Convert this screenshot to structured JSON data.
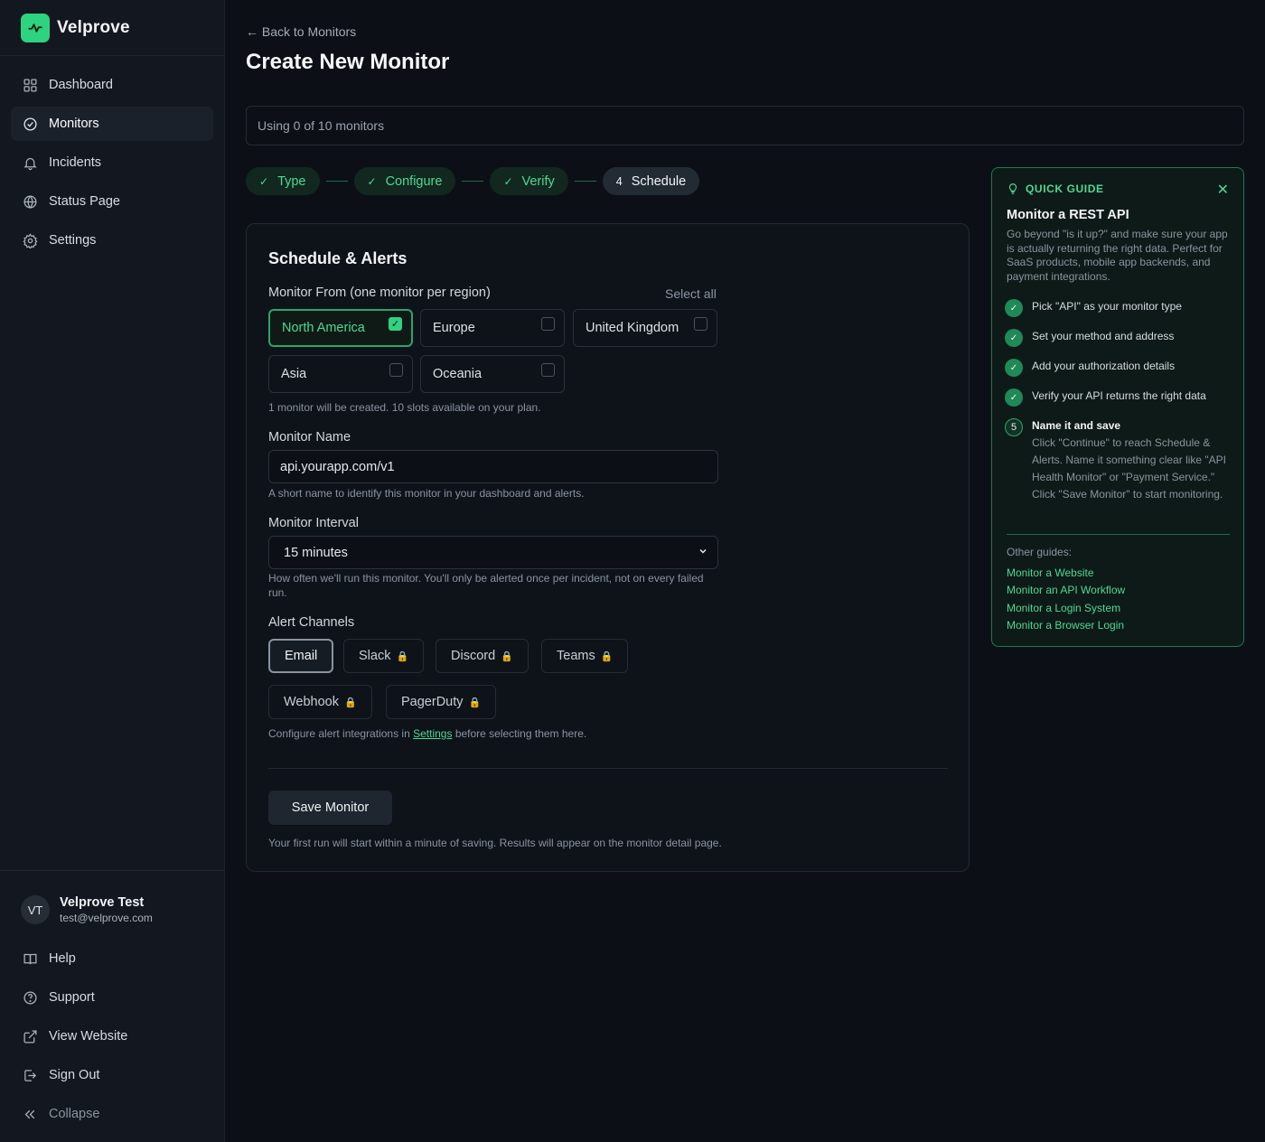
{
  "brand": {
    "name": "Velprove",
    "logo_icon": "activity-icon",
    "accent": "#2fd27f"
  },
  "nav": [
    {
      "label": "Dashboard",
      "icon": "grid-icon",
      "active": false
    },
    {
      "label": "Monitors",
      "icon": "check-circle-icon",
      "active": true
    },
    {
      "label": "Incidents",
      "icon": "bell-icon",
      "active": false
    },
    {
      "label": "Status Page",
      "icon": "globe-icon",
      "active": false
    },
    {
      "label": "Settings",
      "icon": "gear-icon",
      "active": false
    }
  ],
  "user": {
    "initials": "VT",
    "name": "Velprove Test",
    "email": "test@velprove.com"
  },
  "bottom_nav": [
    {
      "label": "Help",
      "icon": "book-icon"
    },
    {
      "label": "Support",
      "icon": "help-circle-icon"
    },
    {
      "label": "View Website",
      "icon": "external-link-icon"
    },
    {
      "label": "Sign Out",
      "icon": "sign-out-icon"
    },
    {
      "label": "Collapse",
      "icon": "chevrons-left-icon"
    }
  ],
  "header": {
    "back": "← Back to Monitors",
    "title": "Create New Monitor"
  },
  "usage": "Using 0 of 10 monitors",
  "steps": [
    {
      "label": "Type",
      "status": "done"
    },
    {
      "label": "Configure",
      "status": "done"
    },
    {
      "label": "Verify",
      "status": "done"
    },
    {
      "label": "Schedule",
      "number": "4",
      "status": "current"
    }
  ],
  "form": {
    "title": "Schedule & Alerts",
    "regions_label": "Monitor From (one monitor per region)",
    "select_all": "Select all",
    "regions": [
      {
        "label": "North America",
        "checked": true
      },
      {
        "label": "Europe",
        "checked": false
      },
      {
        "label": "United Kingdom",
        "checked": false
      },
      {
        "label": "Asia",
        "checked": false
      },
      {
        "label": "Oceania",
        "checked": false
      }
    ],
    "regions_hint": "1 monitor will be created. 10 slots available on your plan.",
    "name_label": "Monitor Name",
    "name_value": "api.yourapp.com/v1",
    "name_hint": "A short name to identify this monitor in your dashboard and alerts.",
    "interval_label": "Monitor Interval",
    "interval_value": "15 minutes",
    "interval_hint": "How often we'll run this monitor. You'll only be alerted once per incident, not on every failed run.",
    "alerts_label": "Alert Channels",
    "channels": [
      {
        "label": "Email",
        "selected": true,
        "locked": false
      },
      {
        "label": "Slack",
        "selected": false,
        "locked": true
      },
      {
        "label": "Discord",
        "selected": false,
        "locked": true
      },
      {
        "label": "Teams",
        "selected": false,
        "locked": true
      },
      {
        "label": "Webhook",
        "selected": false,
        "locked": true
      },
      {
        "label": "PagerDuty",
        "selected": false,
        "locked": true
      }
    ],
    "alerts_hint_pre": "Configure alert integrations in",
    "alerts_hint_link": "Settings",
    "alerts_hint_post": "before selecting them here.",
    "save": "Save Monitor",
    "save_hint": "Your first run will start within a minute of saving. Results will appear on the monitor detail page."
  },
  "guide": {
    "heading": "QUICK GUIDE",
    "title": "Monitor a REST API",
    "description": "Go beyond \"is it up?\" and make sure your app is actually returning the right data. Perfect for SaaS products, mobile app backends, and payment integrations.",
    "steps": [
      {
        "text": "Pick \"API\" as your monitor type",
        "done": true
      },
      {
        "text": "Set your method and address",
        "done": true
      },
      {
        "text": "Add your authorization details",
        "done": true
      },
      {
        "text": "Verify your API returns the right data",
        "done": true
      },
      {
        "number": "5",
        "text": "Name it and save",
        "detail": "Click \"Continue\" to reach Schedule & Alerts. Name it something clear like \"API Health Monitor\" or \"Payment Service.\" Click \"Save Monitor\" to start monitoring.",
        "done": false
      }
    ],
    "other_label": "Other guides:",
    "links": [
      "Monitor a Website",
      "Monitor an API Workflow",
      "Monitor a Login System",
      "Monitor a Browser Login"
    ]
  }
}
